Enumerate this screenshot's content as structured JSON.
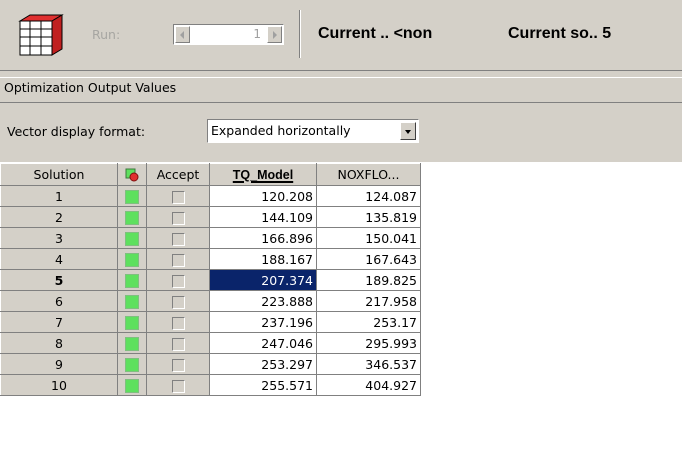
{
  "toolbar": {
    "run_label": "Run:",
    "run_spinner_value": "1",
    "current_text_1": "Current .. <non",
    "current_text_2": "Current so.. 5"
  },
  "panel": {
    "title": "Optimization Output Values"
  },
  "format": {
    "label": "Vector display format:",
    "selected": "Expanded horizontally"
  },
  "grid": {
    "headers": {
      "solution": "Solution",
      "accept": "Accept",
      "tq_model": "TQ_Model",
      "noxflo": "NOXFLO..."
    },
    "rows": [
      {
        "solution": "1",
        "tq": "120.208",
        "nox": "124.087"
      },
      {
        "solution": "2",
        "tq": "144.109",
        "nox": "135.819"
      },
      {
        "solution": "3",
        "tq": "166.896",
        "nox": "150.041"
      },
      {
        "solution": "4",
        "tq": "188.167",
        "nox": "167.643"
      },
      {
        "solution": "5",
        "tq": "207.374",
        "nox": "189.825"
      },
      {
        "solution": "6",
        "tq": "223.888",
        "nox": "217.958"
      },
      {
        "solution": "7",
        "tq": "237.196",
        "nox": "253.17"
      },
      {
        "solution": "8",
        "tq": "247.046",
        "nox": "295.993"
      },
      {
        "solution": "9",
        "tq": "253.297",
        "nox": "346.537"
      },
      {
        "solution": "10",
        "tq": "255.571",
        "nox": "404.927"
      }
    ],
    "selected_row": "5"
  },
  "colors": {
    "status_green": "#5ee05e",
    "selection_blue": "#0a246a",
    "face": "#d4d0c8"
  },
  "icons": {
    "toolbar": "table-view-icon",
    "status_header": "status-light-icon"
  }
}
